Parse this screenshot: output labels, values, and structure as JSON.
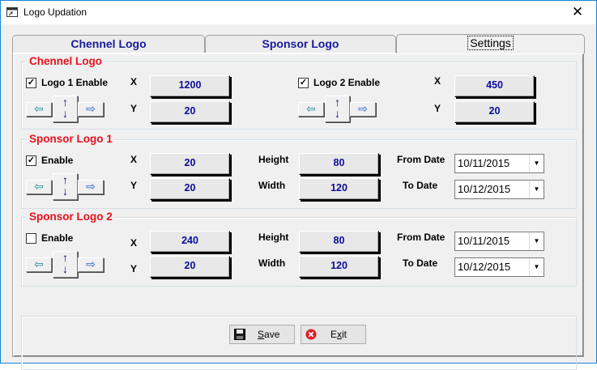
{
  "window": {
    "title": "Logo Updation",
    "close_glyph": "✕"
  },
  "tabs": [
    {
      "label": "Chennel Logo",
      "active": false
    },
    {
      "label": "Sponsor Logo",
      "active": false
    },
    {
      "label": "Settings",
      "active": true
    }
  ],
  "chennel_logo": {
    "title": "Chennel Logo",
    "logo1": {
      "enable_label": "Logo 1 Enable",
      "checked": true,
      "x_label": "X",
      "y_label": "Y",
      "x": "1200",
      "y": "20"
    },
    "logo2": {
      "enable_label": "Logo 2 Enable",
      "checked": true,
      "x_label": "X",
      "y_label": "Y",
      "x": "450",
      "y": "20"
    }
  },
  "sponsor_logo_1": {
    "title": "Sponsor Logo 1",
    "enable_label": "Enable",
    "checked": true,
    "x_label": "X",
    "y_label": "Y",
    "x": "20",
    "y": "20",
    "height_label": "Height",
    "width_label": "Width",
    "height": "80",
    "width": "120",
    "from_label": "From Date",
    "to_label": "To Date",
    "from_date": "10/11/2015",
    "to_date": "10/12/2015"
  },
  "sponsor_logo_2": {
    "title": "Sponsor Logo 2",
    "enable_label": "Enable",
    "checked": false,
    "x_label": "X",
    "y_label": "Y",
    "x": "240",
    "y": "20",
    "height_label": "Height",
    "width_label": "Width",
    "height": "80",
    "width": "120",
    "from_label": "From Date",
    "to_label": "To Date",
    "from_date": "10/11/2015",
    "to_date": "10/12/2015"
  },
  "buttons": {
    "save": {
      "prefix": "",
      "accel": "S",
      "suffix": "ave"
    },
    "exit": {
      "prefix": "E",
      "accel": "x",
      "suffix": "it"
    }
  },
  "glyphs": {
    "check": "✓",
    "left": "⇦",
    "right": "⇨",
    "up": "↑",
    "down": "↓",
    "dropdown": "▼"
  },
  "colors": {
    "accent_blue": "#0b0b9c",
    "legend_red": "#e8121d",
    "exit_icon": "#e01b24"
  }
}
